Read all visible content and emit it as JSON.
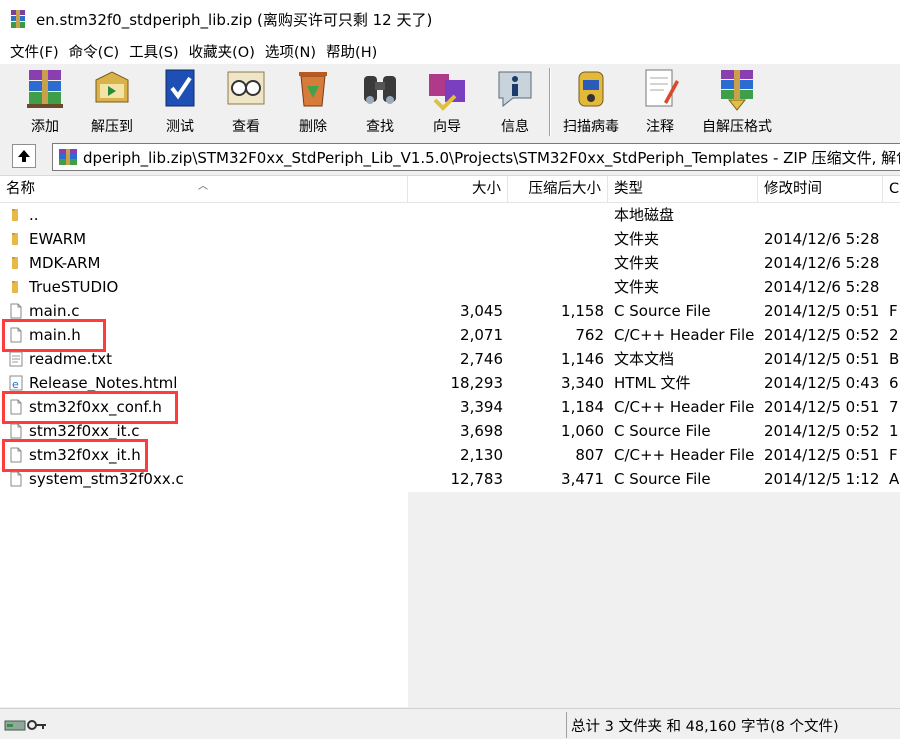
{
  "window": {
    "title": "en.stm32f0_stdperiph_lib.zip (离购买许可只剩 12 天了)"
  },
  "menu": [
    "文件(F)",
    "命令(C)",
    "工具(S)",
    "收藏夹(O)",
    "选项(N)",
    "帮助(H)"
  ],
  "toolbar": [
    {
      "label": "添加",
      "icon": "archive-add-icon"
    },
    {
      "label": "解压到",
      "icon": "extract-to-icon"
    },
    {
      "label": "测试",
      "icon": "test-archive-icon"
    },
    {
      "label": "查看",
      "icon": "view-glasses-icon"
    },
    {
      "label": "删除",
      "icon": "delete-recycle-icon"
    },
    {
      "label": "查找",
      "icon": "find-binoculars-icon"
    },
    {
      "label": "向导",
      "icon": "wizard-icon"
    },
    {
      "label": "信息",
      "icon": "info-icon"
    },
    {
      "label": "扫描病毒",
      "icon": "virus-scan-icon"
    },
    {
      "label": "注释",
      "icon": "comment-icon"
    },
    {
      "label": "自解压格式",
      "icon": "sfx-archive-icon"
    }
  ],
  "address": {
    "path": "dperiph_lib.zip\\STM32F0xx_StdPeriph_Lib_V1.5.0\\Projects\\STM32F0xx_StdPeriph_Templates - ZIP 压缩文件, 解包大"
  },
  "columns": {
    "name": "名称",
    "size": "大小",
    "packed": "压缩后大小",
    "type": "类型",
    "modified": "修改时间",
    "crc": "C"
  },
  "files": [
    {
      "name": "..",
      "size": "",
      "packed": "",
      "type": "本地磁盘",
      "modified": "",
      "crc": "",
      "icon": "folder-icon",
      "highlighted": false
    },
    {
      "name": "EWARM",
      "size": "",
      "packed": "",
      "type": "文件夹",
      "modified": "2014/12/6 5:28",
      "crc": "",
      "icon": "folder-icon",
      "highlighted": false
    },
    {
      "name": "MDK-ARM",
      "size": "",
      "packed": "",
      "type": "文件夹",
      "modified": "2014/12/6 5:28",
      "crc": "",
      "icon": "folder-icon",
      "highlighted": false
    },
    {
      "name": "TrueSTUDIO",
      "size": "",
      "packed": "",
      "type": "文件夹",
      "modified": "2014/12/6 5:28",
      "crc": "",
      "icon": "folder-icon",
      "highlighted": false
    },
    {
      "name": "main.c",
      "size": "3,045",
      "packed": "1,158",
      "type": "C Source File",
      "modified": "2014/12/5 0:51",
      "crc": "F",
      "icon": "file-icon",
      "highlighted": false
    },
    {
      "name": "main.h",
      "size": "2,071",
      "packed": "762",
      "type": "C/C++ Header File",
      "modified": "2014/12/5 0:52",
      "crc": "2",
      "icon": "file-icon",
      "highlighted": true
    },
    {
      "name": "readme.txt",
      "size": "2,746",
      "packed": "1,146",
      "type": "文本文档",
      "modified": "2014/12/5 0:51",
      "crc": "B",
      "icon": "text-file-icon",
      "highlighted": false
    },
    {
      "name": "Release_Notes.html",
      "size": "18,293",
      "packed": "3,340",
      "type": "HTML 文件",
      "modified": "2014/12/5 0:43",
      "crc": "6",
      "icon": "html-file-icon",
      "highlighted": false
    },
    {
      "name": "stm32f0xx_conf.h",
      "size": "3,394",
      "packed": "1,184",
      "type": "C/C++ Header File",
      "modified": "2014/12/5 0:51",
      "crc": "7",
      "icon": "file-icon",
      "highlighted": true
    },
    {
      "name": "stm32f0xx_it.c",
      "size": "3,698",
      "packed": "1,060",
      "type": "C Source File",
      "modified": "2014/12/5 0:52",
      "crc": "1",
      "icon": "file-icon",
      "highlighted": false
    },
    {
      "name": "stm32f0xx_it.h",
      "size": "2,130",
      "packed": "807",
      "type": "C/C++ Header File",
      "modified": "2014/12/5 0:51",
      "crc": "F",
      "icon": "file-icon",
      "highlighted": true
    },
    {
      "name": "system_stm32f0xx.c",
      "size": "12,783",
      "packed": "3,471",
      "type": "C Source File",
      "modified": "2014/12/5 1:12",
      "crc": "A",
      "icon": "file-icon",
      "highlighted": false
    }
  ],
  "status": {
    "summary": "总计 3 文件夹 和 48,160 字节(8 个文件)"
  },
  "colors": {
    "highlight": "#ff3b3b",
    "folder": "#e8b84a",
    "window_bg": "#f0f0f0"
  }
}
